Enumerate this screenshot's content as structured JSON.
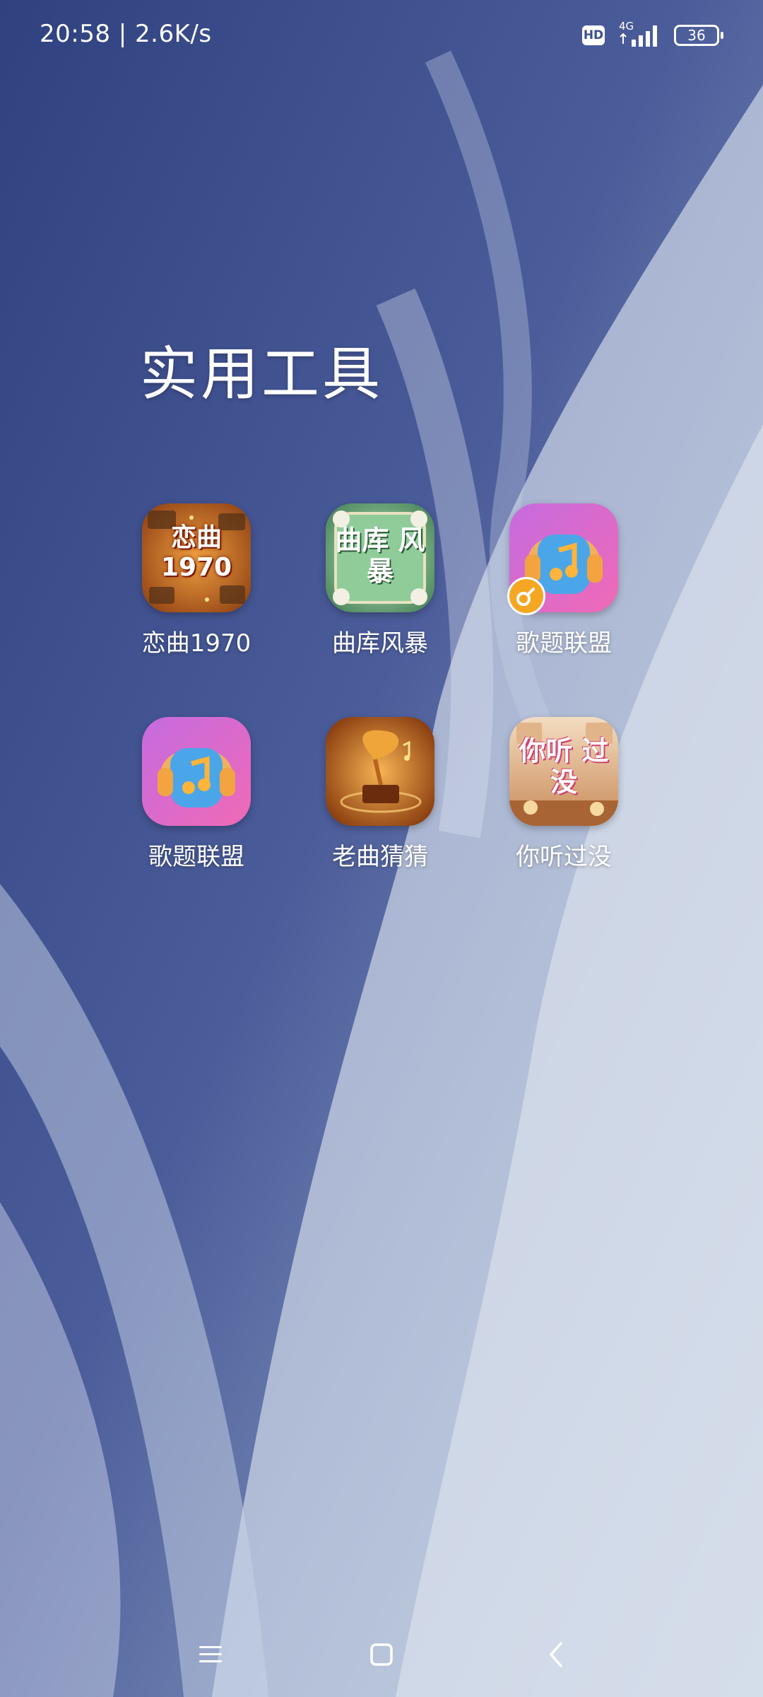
{
  "status_bar": {
    "time_speed": "20:58 | 2.6K/s",
    "hd": "HD",
    "network": "4G",
    "battery": "36"
  },
  "folder": {
    "title": "实用工具",
    "apps": [
      {
        "label": "恋曲1970",
        "icon": "music-cassette-icon",
        "icon_text": "恋曲 1970"
      },
      {
        "label": "曲库风暴",
        "icon": "green-jade-icon",
        "icon_text": "曲库 风暴"
      },
      {
        "label": "歌题联盟",
        "icon": "headphone-music-icon",
        "has_badge": true
      },
      {
        "label": "歌题联盟",
        "icon": "headphone-music-icon"
      },
      {
        "label": "老曲猜猜",
        "icon": "gramophone-icon"
      },
      {
        "label": "你听过没",
        "icon": "kitchen-text-icon",
        "icon_text": "你听 过没"
      }
    ]
  },
  "nav_bar": {
    "menu": "menu-icon",
    "home": "home-icon",
    "back": "back-icon"
  }
}
